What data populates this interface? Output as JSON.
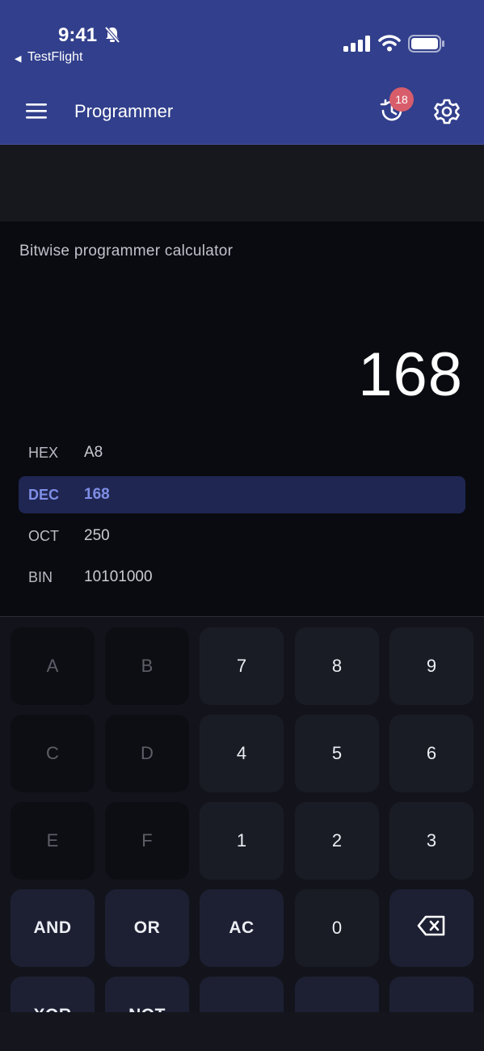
{
  "status_bar": {
    "time": "9:41",
    "back_label": "TestFlight",
    "back_arrow": "◀"
  },
  "app_bar": {
    "title": "Programmer",
    "history_badge": "18",
    "accent": "#313f8c"
  },
  "display": {
    "subtitle": "Bitwise programmer calculator",
    "value": "168",
    "bases": [
      {
        "label": "HEX",
        "value": "A8"
      },
      {
        "label": "DEC",
        "value": "168"
      },
      {
        "label": "OCT",
        "value": "250"
      },
      {
        "label": "BIN",
        "value": "10101000"
      }
    ],
    "active_base": "DEC",
    "active_color": "#7f8ee6"
  },
  "keypad": {
    "rows": [
      [
        "A",
        "B",
        "7",
        "8",
        "9"
      ],
      [
        "C",
        "D",
        "4",
        "5",
        "6"
      ],
      [
        "E",
        "F",
        "1",
        "2",
        "3"
      ],
      [
        "AND",
        "OR",
        "AC",
        "0",
        "backspace-icon"
      ],
      [
        "XOR",
        "NOT",
        "",
        "",
        ""
      ]
    ],
    "disabled_keys": [
      "A",
      "B",
      "C",
      "D",
      "E",
      "F"
    ]
  },
  "icons": [
    "menu-icon",
    "history-icon",
    "gear-icon",
    "bell-slash-icon",
    "signal-icon",
    "wifi-icon",
    "battery-icon",
    "backspace-icon"
  ]
}
